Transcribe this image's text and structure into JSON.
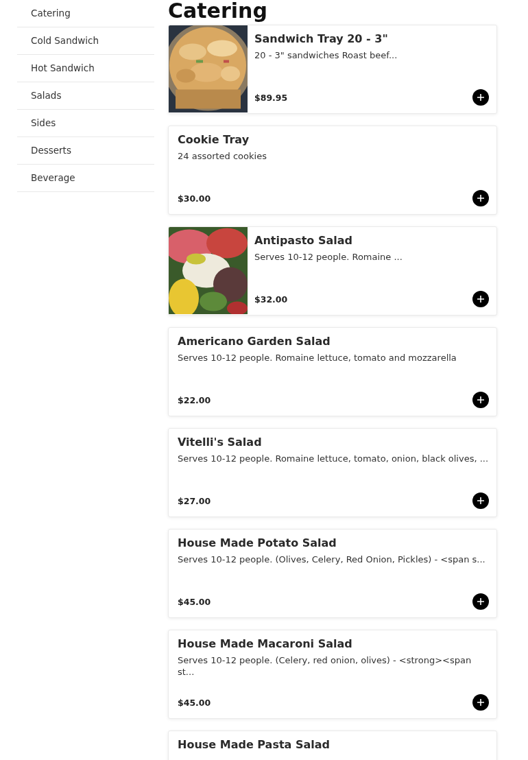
{
  "sidebar": {
    "items": [
      {
        "label": "Catering"
      },
      {
        "label": "Cold Sandwich"
      },
      {
        "label": "Hot Sandwich"
      },
      {
        "label": "Salads"
      },
      {
        "label": "Sides"
      },
      {
        "label": "Desserts"
      },
      {
        "label": "Beverage"
      }
    ]
  },
  "heading": "Catering",
  "products": [
    {
      "kind": "picture",
      "title": "Sandwich Tray 20 - 3\"",
      "description": "20 - 3\" sandwiches Roast beef...",
      "price": "$89.95"
    },
    {
      "kind": "plain",
      "title": "Cookie Tray",
      "description": "24 assorted cookies",
      "price": "$30.00"
    },
    {
      "kind": "picture",
      "title": "Antipasto Salad",
      "description": "Serves 10-12 people. Romaine ...",
      "price": "$32.00"
    },
    {
      "kind": "plain",
      "title": "Americano Garden Salad",
      "description": "Serves 10-12 people. Romaine lettuce, tomato and mozzarella",
      "price": "$22.00"
    },
    {
      "kind": "plain",
      "title": "Vitelli's Salad",
      "description": "Serves 10-12 people. Romaine lettuce, tomato, onion, black olives, ...",
      "price": "$27.00"
    },
    {
      "kind": "plain",
      "title": "House Made Potato Salad",
      "description": "Serves 10-12 people. (Olives, Celery, Red Onion, Pickles) - <span s...",
      "price": "$45.00"
    },
    {
      "kind": "plain",
      "title": "House Made Macaroni Salad",
      "description": "Serves 10-12 people. (Celery, red onion, olives) - <strong><span st...",
      "price": "$45.00"
    },
    {
      "kind": "plain",
      "title": "House Made Pasta Salad"
    }
  ]
}
